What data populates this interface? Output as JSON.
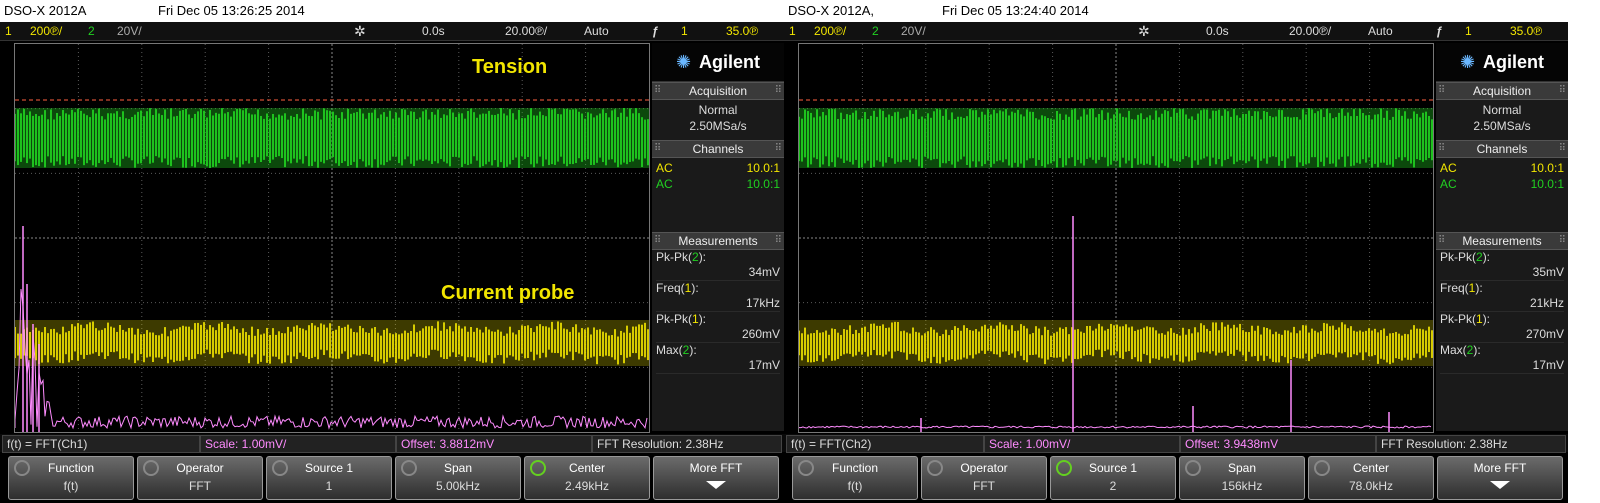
{
  "left": {
    "title": {
      "model": "DSO-X 2012A",
      "datetime": "Fri Dec 05 13:26:25 2014"
    },
    "status": {
      "ch1_num": "1",
      "ch1_scale": "200℗/",
      "ch2_num": "2",
      "ch2_scale": "20V/",
      "delay": "0.0s",
      "timebase": "20.00℗/",
      "mode": "Auto",
      "trig_src": "1",
      "trig_level": "35.0℗"
    },
    "annotations": {
      "top": "Tension",
      "bottom": "Current probe"
    },
    "brand": "Agilent",
    "acquisition": {
      "header": "Acquisition",
      "mode": "Normal",
      "rate": "2.50MSa/s"
    },
    "channels": {
      "header": "Channels",
      "rows": [
        {
          "coupling": "AC",
          "ratio": "10.0:1"
        },
        {
          "coupling": "AC",
          "ratio": "10.0:1"
        }
      ]
    },
    "measurements": {
      "header": "Measurements",
      "items": [
        {
          "label_pre": "Pk-Pk(",
          "label_ch": "2",
          "label_post": "):",
          "value": "34mV"
        },
        {
          "label_pre": "Freq(",
          "label_ch": "1",
          "label_post": "):",
          "value": "17kHz"
        },
        {
          "label_pre": "Pk-Pk(",
          "label_ch": "1",
          "label_post": "):",
          "value": "260mV"
        },
        {
          "label_pre": "Max(",
          "label_ch": "2",
          "label_post": "):",
          "value": "17mV"
        }
      ]
    },
    "fft": {
      "func": "f(t) = FFT(Ch1)",
      "scale": "Scale: 1.00mV/",
      "offset": "Offset: 3.8812mV",
      "resolution": "FFT Resolution: 2.38Hz"
    },
    "softkeys": [
      {
        "title": "Function",
        "value": "f(t)"
      },
      {
        "title": "Operator",
        "value": "FFT"
      },
      {
        "title": "Source 1",
        "value": "1"
      },
      {
        "title": "Span",
        "value": "5.00kHz"
      },
      {
        "title": "Center",
        "value": "2.49kHz"
      },
      {
        "title": "More FFT",
        "value": ""
      }
    ]
  },
  "right": {
    "title": {
      "model": "DSO-X 2012A,",
      "datetime": "Fri Dec 05 13:24:40 2014"
    },
    "status": {
      "ch1_num": "1",
      "ch1_scale": "200℗/",
      "ch2_num": "2",
      "ch2_scale": "20V/",
      "delay": "0.0s",
      "timebase": "20.00℗/",
      "mode": "Auto",
      "trig_src": "1",
      "trig_level": "35.0℗"
    },
    "brand": "Agilent",
    "acquisition": {
      "header": "Acquisition",
      "mode": "Normal",
      "rate": "2.50MSa/s"
    },
    "channels": {
      "header": "Channels",
      "rows": [
        {
          "coupling": "AC",
          "ratio": "10.0:1"
        },
        {
          "coupling": "AC",
          "ratio": "10.0:1"
        }
      ]
    },
    "measurements": {
      "header": "Measurements",
      "items": [
        {
          "label_pre": "Pk-Pk(",
          "label_ch": "2",
          "label_post": "):",
          "value": "35mV"
        },
        {
          "label_pre": "Freq(",
          "label_ch": "1",
          "label_post": "):",
          "value": "21kHz"
        },
        {
          "label_pre": "Pk-Pk(",
          "label_ch": "1",
          "label_post": "):",
          "value": "270mV"
        },
        {
          "label_pre": "Max(",
          "label_ch": "2",
          "label_post": "):",
          "value": "17mV"
        }
      ]
    },
    "fft": {
      "func": "f(t) = FFT(Ch2)",
      "scale": "Scale: 1.00mV/",
      "offset": "Offset: 3.9438mV",
      "resolution": "FFT Resolution: 2.38Hz"
    },
    "softkeys": [
      {
        "title": "Function",
        "value": "f(t)"
      },
      {
        "title": "Operator",
        "value": "FFT"
      },
      {
        "title": "Source 1",
        "value": "2"
      },
      {
        "title": "Span",
        "value": "156kHz"
      },
      {
        "title": "Center",
        "value": "78.0kHz"
      },
      {
        "title": "More FFT",
        "value": ""
      }
    ]
  },
  "colors": {
    "ch1": "#f2e600",
    "ch2": "#21d021",
    "math": "#ff8cff",
    "grid": "#5a5a5a",
    "trigger_line": "#ff6040"
  }
}
